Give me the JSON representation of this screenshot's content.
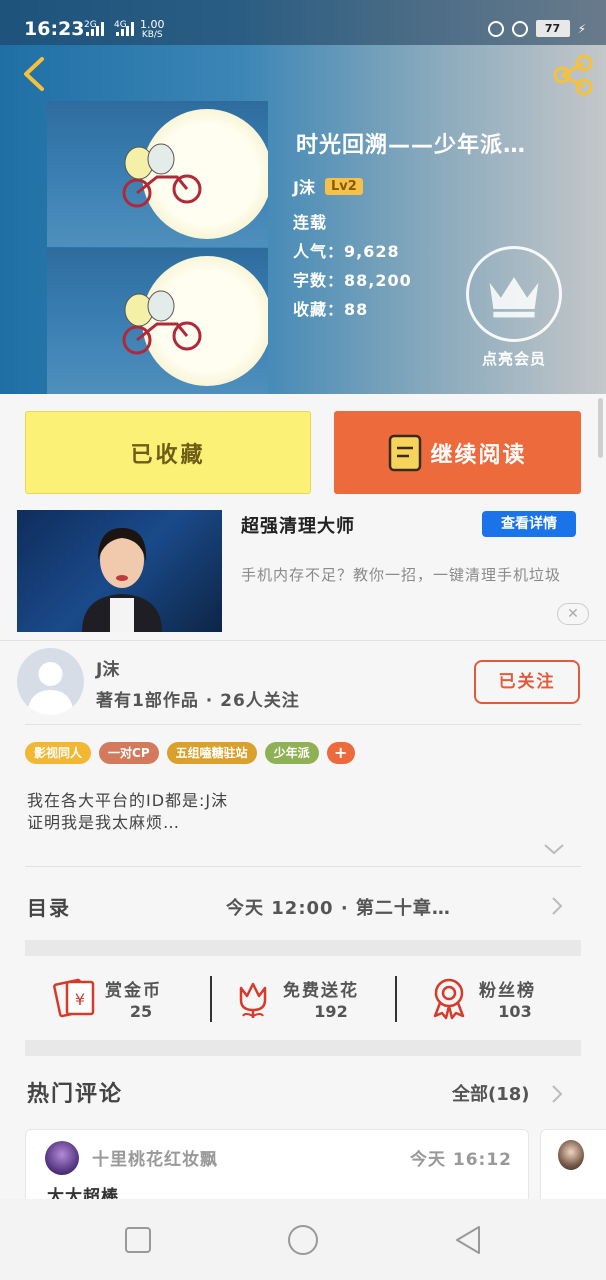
{
  "status_bar": {
    "time": "16:23",
    "net1": "2G",
    "net2": "4G",
    "speed": "1.00",
    "speed_unit": "KB/S",
    "battery": "77"
  },
  "book": {
    "title": "时光回溯——少年派…",
    "author": "J沫",
    "level": "Lv2",
    "status": "连载",
    "popularity": "人气：9,628",
    "word_count": "字数：88,200",
    "favorites": "收藏：88",
    "vip_label": "点亮会员"
  },
  "actions": {
    "collected_label": "已收藏",
    "read_label": "继续阅读"
  },
  "ad": {
    "title": "超强清理大师",
    "detail_label": "查看详情",
    "desc": "手机内存不足？教你一招，一键清理手机垃圾",
    "close_symbol": "✕"
  },
  "author": {
    "name": "J沫",
    "stats": "著有1部作品 · 26人关注",
    "follow_label": "已关注"
  },
  "tags": [
    {
      "label": "影视同人",
      "color": "#f2b834"
    },
    {
      "label": "一对CP",
      "color": "#d47a5c"
    },
    {
      "label": "五组嗑糖驻站",
      "color": "#d9a12c"
    },
    {
      "label": "少年派",
      "color": "#8fb155"
    },
    {
      "label": "+",
      "color": "#ec6a3c"
    }
  ],
  "intro": {
    "line1": "我在各大平台的ID都是:J沫",
    "line2": "证明我是我太麻烦…"
  },
  "catalog": {
    "title": "目录",
    "latest": "今天 12:00 · 第二十章…"
  },
  "stats": [
    {
      "label": "赏金币",
      "value": "25",
      "icon": "red-packet-icon"
    },
    {
      "label": "免费送花",
      "value": "192",
      "icon": "flower-icon"
    },
    {
      "label": "粉丝榜",
      "value": "103",
      "icon": "medal-icon"
    }
  ],
  "comments": {
    "title": "热门评论",
    "all_label": "全部(18)",
    "items": [
      {
        "user": "十里桃花红妆飘",
        "time": "今天 16:12",
        "text": "大大超棒"
      }
    ]
  },
  "colors": {
    "accent_orange": "#ec6a3c",
    "collected_yellow": "#fbf176",
    "ad_blue": "#1a73e8",
    "follow_red": "#e35a3a"
  }
}
